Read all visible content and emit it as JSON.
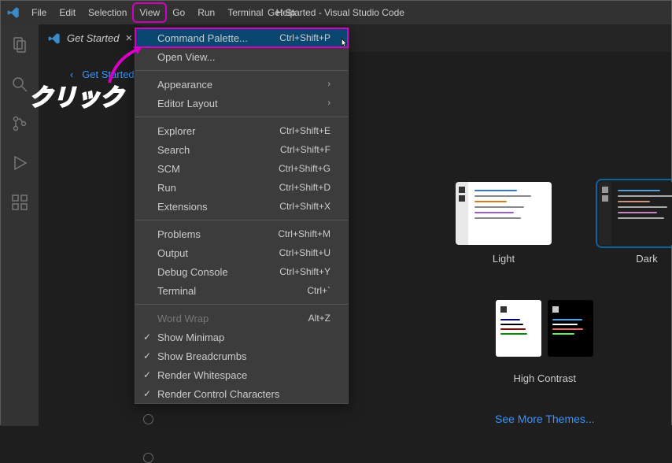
{
  "app": {
    "title": "Get Started - Visual Studio Code"
  },
  "menubar": [
    "File",
    "Edit",
    "Selection",
    "View",
    "Go",
    "Run",
    "Terminal",
    "Help"
  ],
  "activeMenu": "View",
  "tab": {
    "label": "Get Started",
    "close": "×"
  },
  "back": {
    "label": "Get Started",
    "chev": "‹"
  },
  "annotation": "クリック",
  "dropdown": [
    {
      "label": "Command Palette...",
      "shortcut": "Ctrl+Shift+P",
      "hl": true
    },
    {
      "label": "Open View..."
    },
    {
      "sep": true
    },
    {
      "label": "Appearance",
      "sub": true
    },
    {
      "label": "Editor Layout",
      "sub": true
    },
    {
      "sep": true
    },
    {
      "label": "Explorer",
      "shortcut": "Ctrl+Shift+E"
    },
    {
      "label": "Search",
      "shortcut": "Ctrl+Shift+F"
    },
    {
      "label": "SCM",
      "shortcut": "Ctrl+Shift+G"
    },
    {
      "label": "Run",
      "shortcut": "Ctrl+Shift+D"
    },
    {
      "label": "Extensions",
      "shortcut": "Ctrl+Shift+X"
    },
    {
      "sep": true
    },
    {
      "label": "Problems",
      "shortcut": "Ctrl+Shift+M"
    },
    {
      "label": "Output",
      "shortcut": "Ctrl+Shift+U"
    },
    {
      "label": "Debug Console",
      "shortcut": "Ctrl+Shift+Y"
    },
    {
      "label": "Terminal",
      "shortcut": "Ctrl+`"
    },
    {
      "sep": true
    },
    {
      "label": "Word Wrap",
      "shortcut": "Alt+Z",
      "disabled": true
    },
    {
      "label": "Show Minimap",
      "check": true
    },
    {
      "label": "Show Breadcrumbs",
      "check": true
    },
    {
      "label": "Render Whitespace",
      "check": true
    },
    {
      "label": "Render Control Characters",
      "check": true
    }
  ],
  "themes": {
    "light": "Light",
    "dark": "Dark",
    "hc": "High Contrast",
    "more": "See More Themes..."
  },
  "previewLines": {
    "light": [
      "#3377cc",
      "#888",
      "#d67b1a",
      "#888",
      "#9b5fc7",
      "#888"
    ],
    "dark": [
      "#569cd6",
      "#aaa",
      "#ce9178",
      "#aaa",
      "#c586c0",
      "#aaa"
    ],
    "hcA": [
      "#008",
      "#000",
      "#800",
      "#080"
    ],
    "hcB": [
      "#4ae",
      "#fff",
      "#e66",
      "#6e6"
    ]
  }
}
